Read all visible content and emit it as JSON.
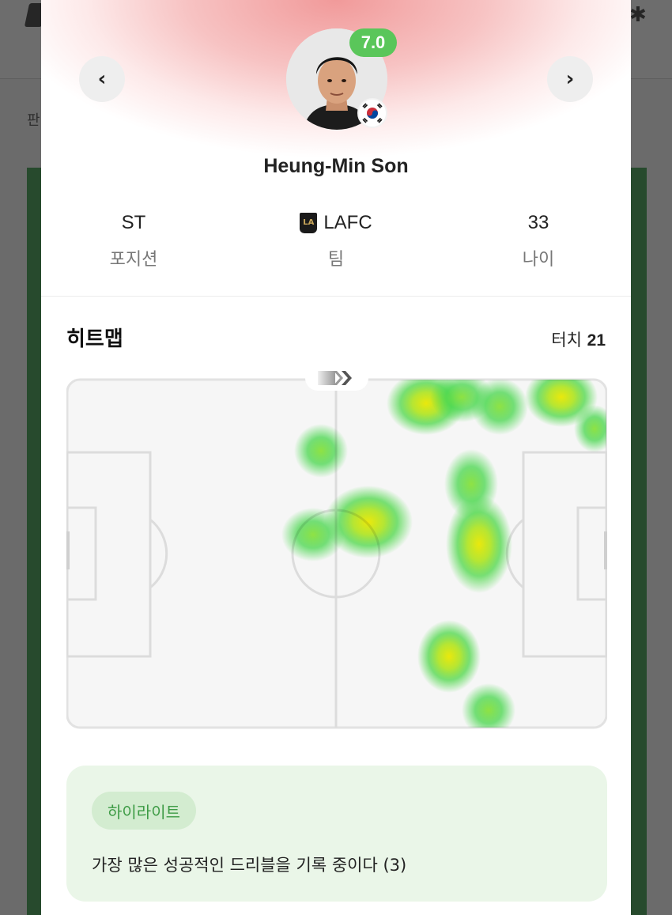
{
  "player": {
    "name": "Heung-Min Son",
    "rating": "7.0",
    "rating_color": "#5ac65a",
    "nationality_flag": "south-korea-flag"
  },
  "nav": {
    "prev_icon": "chevron-left-icon",
    "prev_glyph": "‹",
    "next_icon": "chevron-right-icon",
    "next_glyph": "›"
  },
  "stats": {
    "position": {
      "value": "ST",
      "label": "포지션"
    },
    "team": {
      "value": "LAFC",
      "label": "팀",
      "logo_icon": "lafc-logo-icon"
    },
    "age": {
      "value": "33",
      "label": "나이"
    }
  },
  "heatmap": {
    "title": "히트맵",
    "touches_label": "터치",
    "touches_value": "21",
    "direction_icon": "attack-direction-arrows-icon"
  },
  "highlight": {
    "badge": "하이라이트",
    "text": "가장 많은 성공적인 드리블을 기록 중이다 (3)",
    "accent_color": "#3d9b45"
  }
}
